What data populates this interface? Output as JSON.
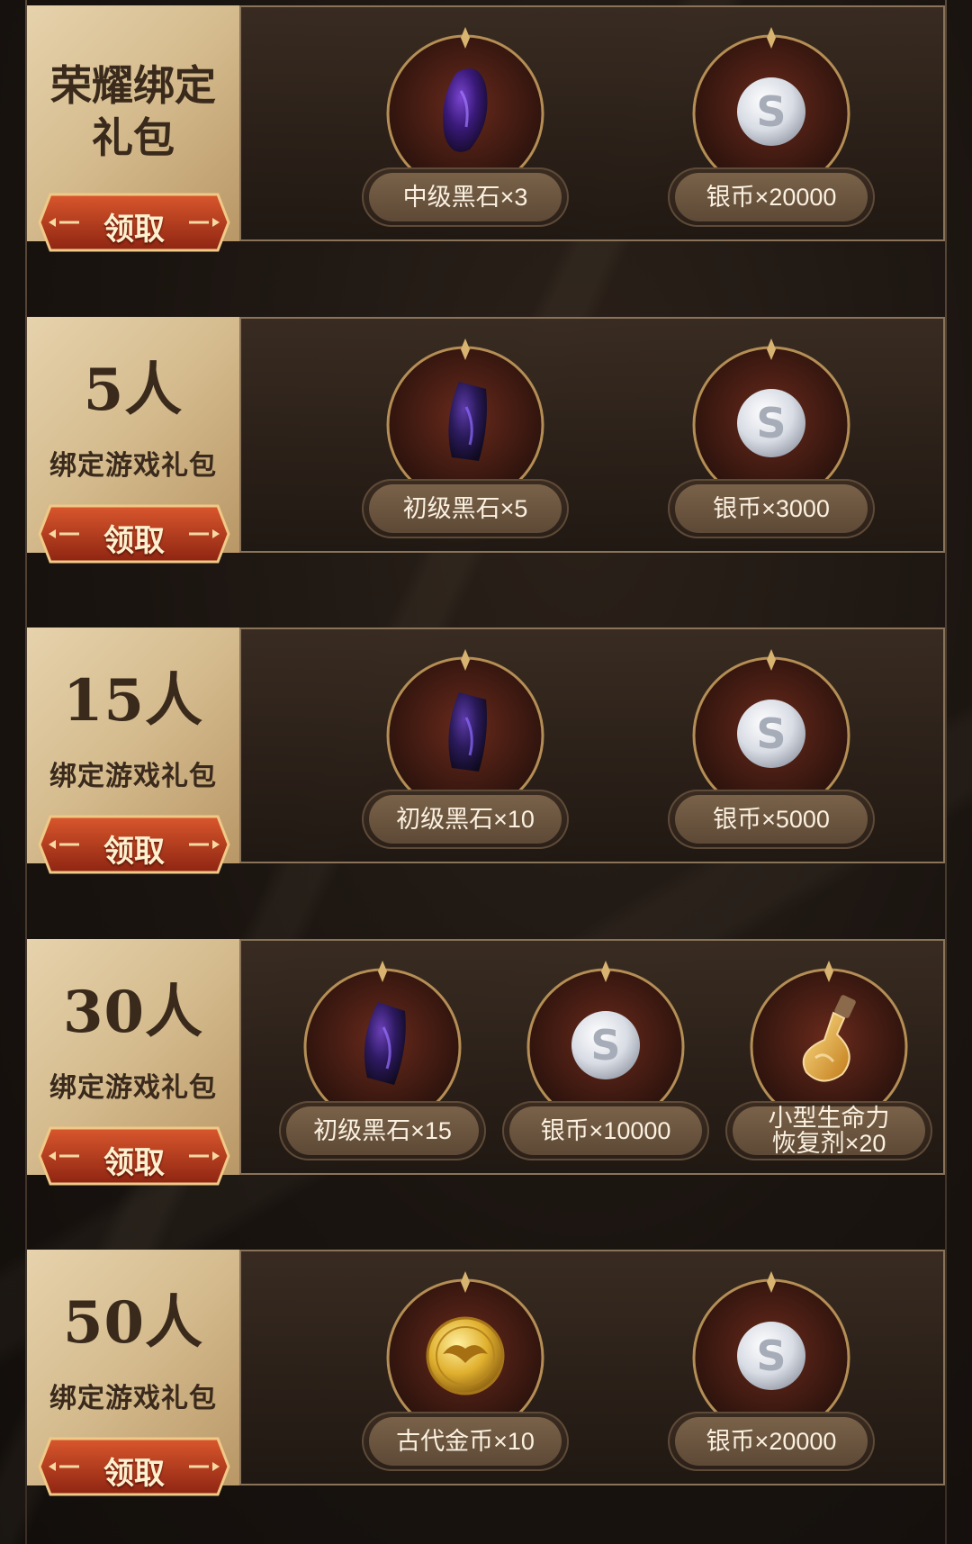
{
  "packs": [
    {
      "title": "荣耀绑定礼包",
      "button": "领取",
      "rewards": [
        {
          "name": "中级黑石×3",
          "icon": "black-stone-icon"
        },
        {
          "name": "银币×20000",
          "icon": "silver-coin-icon"
        }
      ]
    },
    {
      "count": "5人",
      "subtitle": "绑定游戏礼包",
      "button": "领取",
      "rewards": [
        {
          "name": "初级黑石×5",
          "icon": "black-stone-icon"
        },
        {
          "name": "银币×3000",
          "icon": "silver-coin-icon"
        }
      ]
    },
    {
      "count": "15人",
      "subtitle": "绑定游戏礼包",
      "button": "领取",
      "rewards": [
        {
          "name": "初级黑石×10",
          "icon": "black-stone-icon"
        },
        {
          "name": "银币×5000",
          "icon": "silver-coin-icon"
        }
      ]
    },
    {
      "count": "30人",
      "subtitle": "绑定游戏礼包",
      "button": "领取",
      "rewards": [
        {
          "name": "初级黑石×15",
          "icon": "black-stone-icon"
        },
        {
          "name": "银币×10000",
          "icon": "silver-coin-icon"
        },
        {
          "name": "小型生命力恢复剂×20",
          "icon": "potion-icon"
        }
      ]
    },
    {
      "count": "50人",
      "subtitle": "绑定游戏礼包",
      "button": "领取",
      "rewards": [
        {
          "name": "古代金币×10",
          "icon": "gold-coin-icon"
        },
        {
          "name": "银币×20000",
          "icon": "silver-coin-icon"
        }
      ]
    }
  ],
  "colors": {
    "label_gold": "#d6bd90",
    "button_red": "#b3381f",
    "frame_border": "#8a7459"
  }
}
